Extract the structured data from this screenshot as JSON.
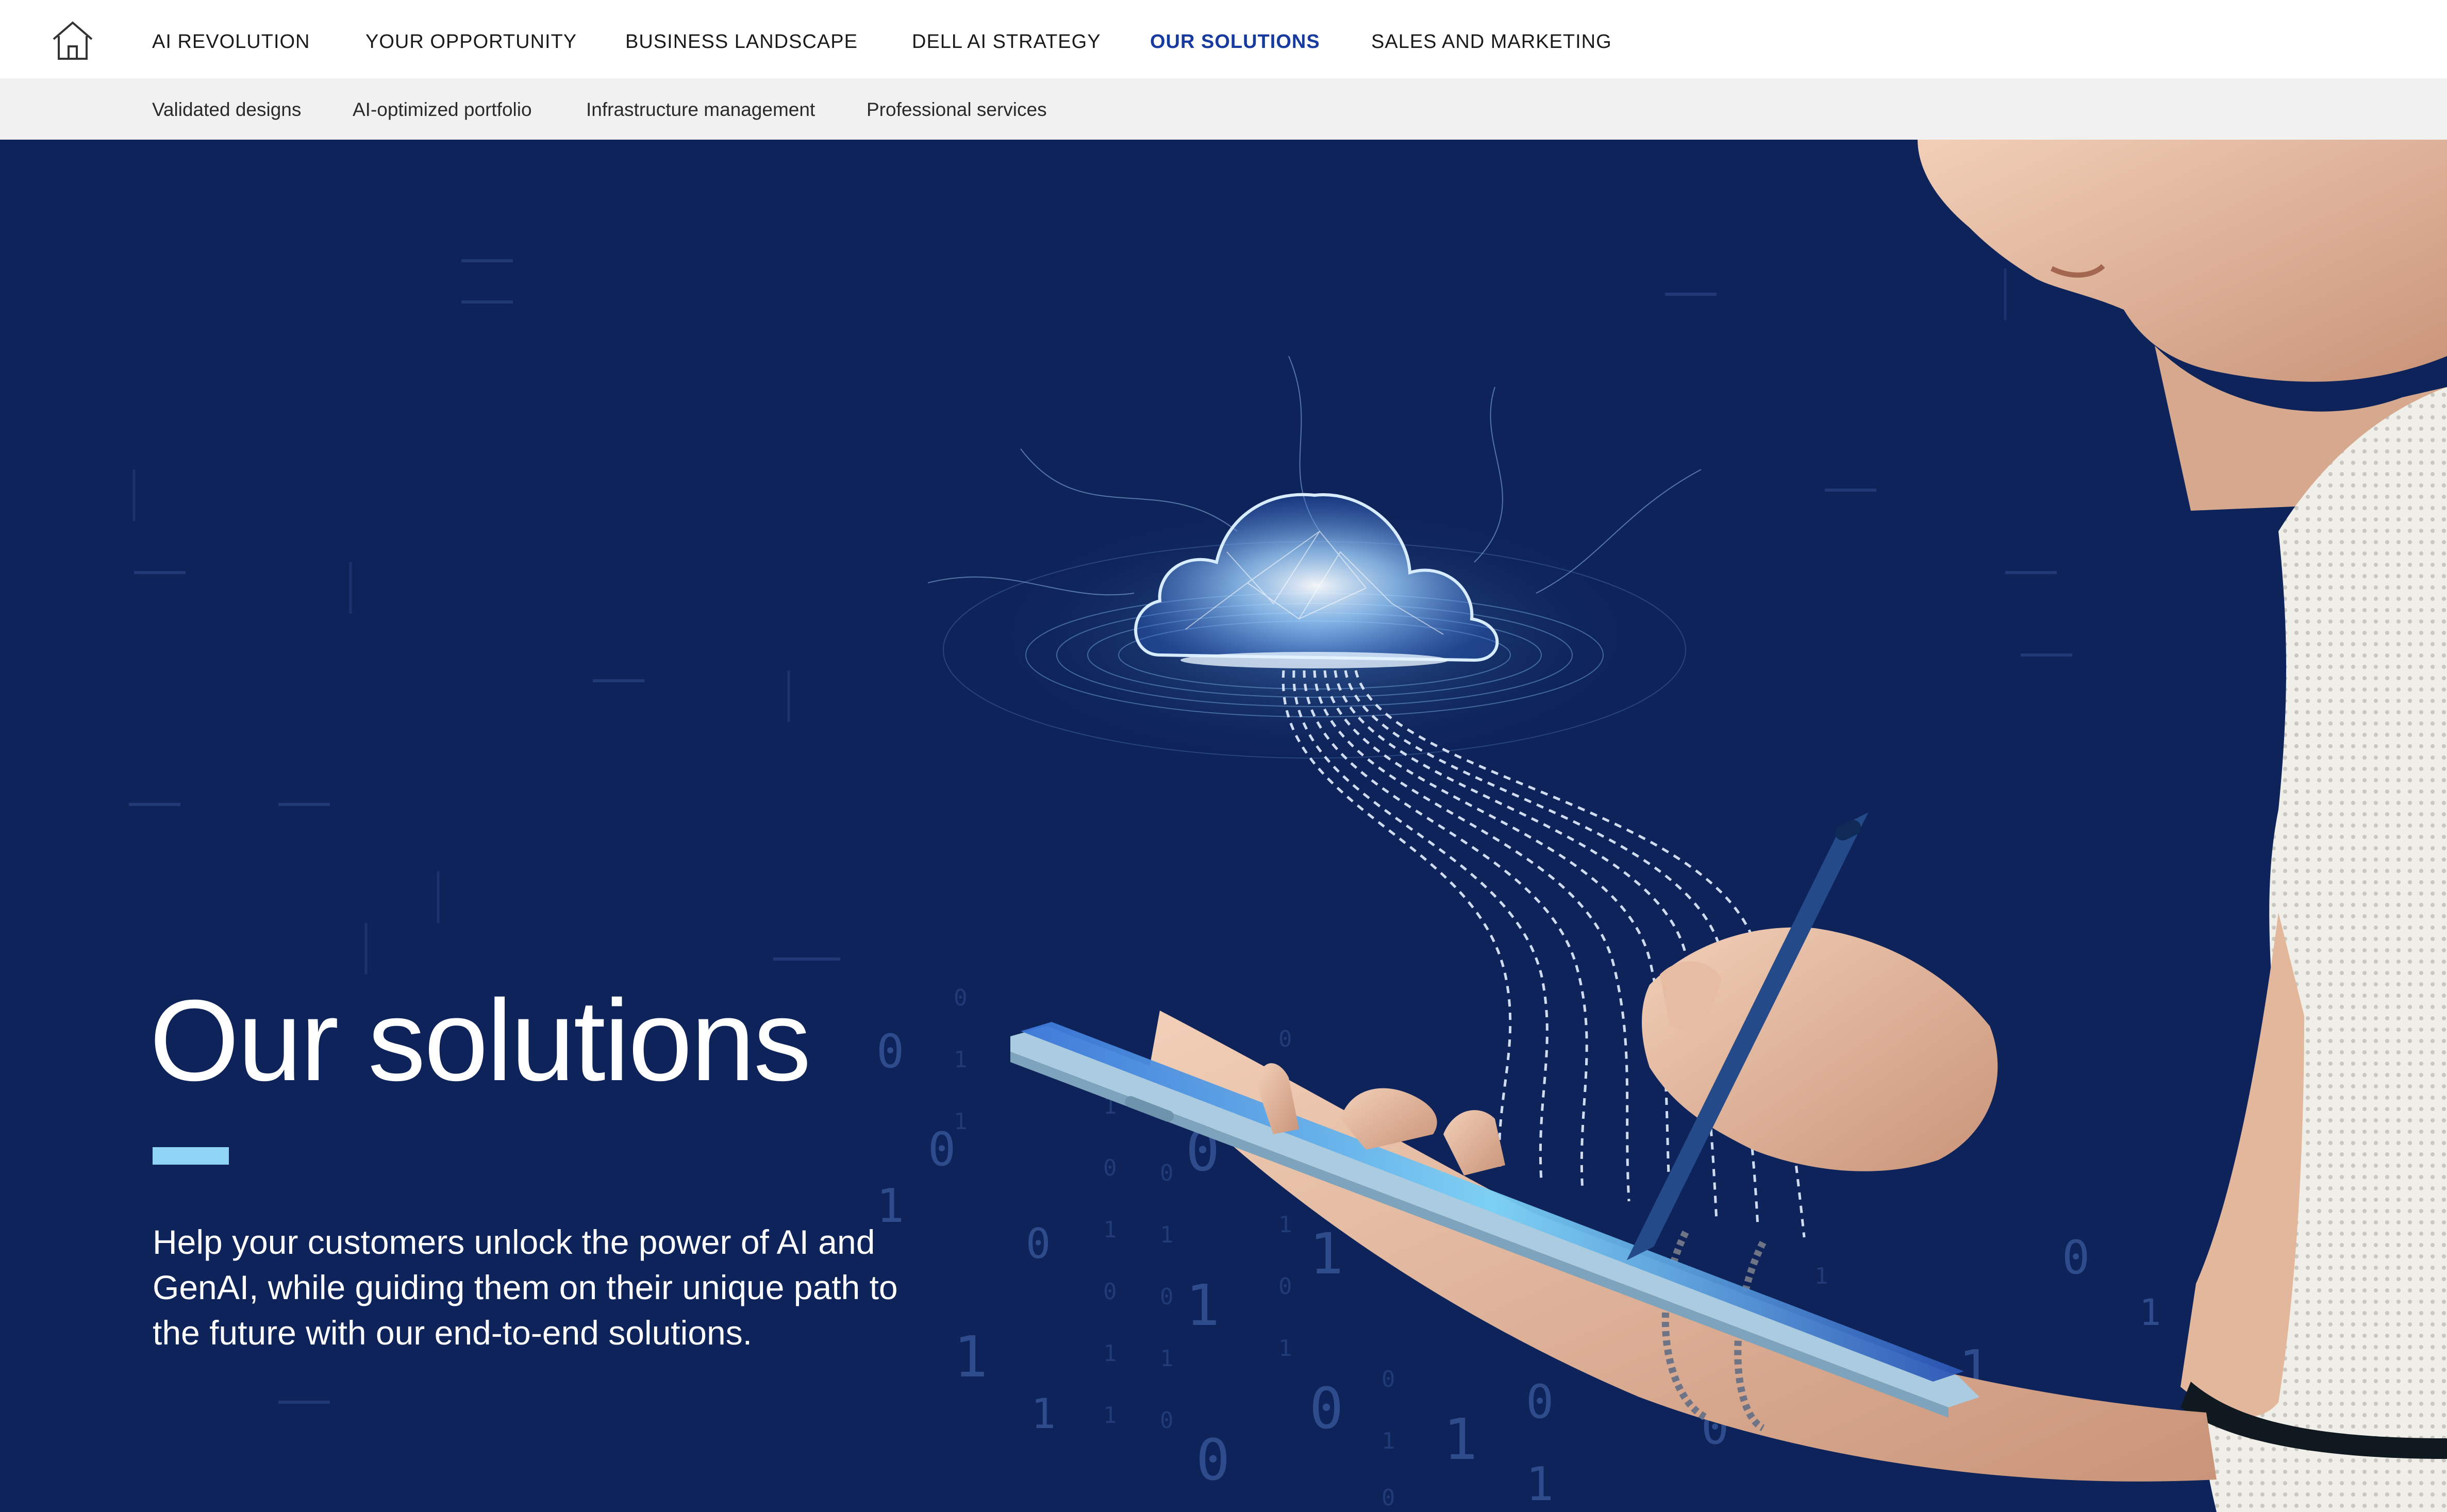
{
  "nav": {
    "home_icon": "home-icon",
    "items": [
      {
        "label": "AI REVOLUTION",
        "active": false
      },
      {
        "label": "YOUR OPPORTUNITY",
        "active": false
      },
      {
        "label": "BUSINESS LANDSCAPE",
        "active": false
      },
      {
        "label": "DELL AI STRATEGY",
        "active": false
      },
      {
        "label": "OUR SOLUTIONS",
        "active": true
      },
      {
        "label": "SALES AND MARKETING",
        "active": false
      }
    ],
    "active_color": "#173a9e"
  },
  "subnav": {
    "items": [
      {
        "label": "Validated designs"
      },
      {
        "label": "AI-optimized portfolio"
      },
      {
        "label": "Infrastructure management"
      },
      {
        "label": "Professional services"
      }
    ]
  },
  "hero": {
    "title": "Our solutions",
    "description": "Help your customers unlock the power of AI and GenAI, while guiding them on their unique path to the future with our end-to-end solutions.",
    "background_color": "#0d2359",
    "accent_color": "#8fd3f5",
    "image_icon": "person-with-tablet-and-ai-cloud-illustration"
  }
}
